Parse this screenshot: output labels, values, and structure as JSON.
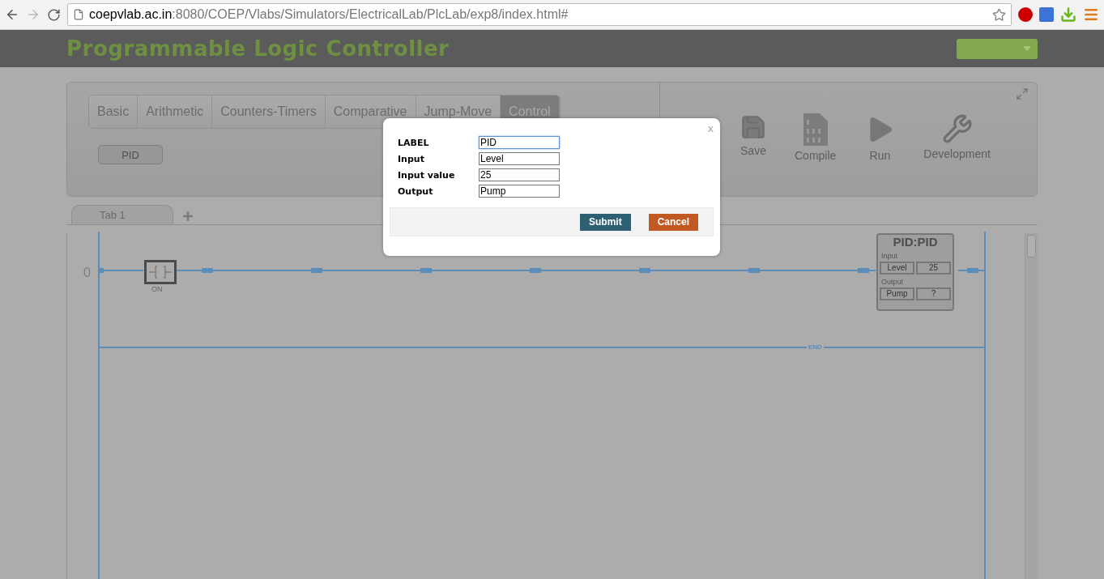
{
  "browser": {
    "url_host": "coepvlab.ac.in",
    "url_path": ":8080/COEP/Vlabs/Simulators/ElectricalLab/PlcLab/exp8/index.html#"
  },
  "header": {
    "title": "Programmable Logic Controller"
  },
  "toolbox": {
    "categories": [
      {
        "label": "Basic",
        "selected": false
      },
      {
        "label": "Arithmetic",
        "selected": false
      },
      {
        "label": "Counters-Timers",
        "selected": false
      },
      {
        "label": "Comparative",
        "selected": false
      },
      {
        "label": "Jump-Move",
        "selected": false
      },
      {
        "label": "Control",
        "selected": true
      }
    ],
    "instructions": [
      {
        "label": "PID"
      }
    ]
  },
  "actions": [
    {
      "label": "Save",
      "kind": "save"
    },
    {
      "label": "Compile",
      "kind": "compile"
    },
    {
      "label": "Run",
      "kind": "run"
    },
    {
      "label": "Development",
      "kind": "development"
    }
  ],
  "sheet_tabs": [
    {
      "label": "Tab 1"
    }
  ],
  "ladder": {
    "rungs": [
      {
        "number": "0",
        "contact": {
          "label": "ON"
        },
        "block": {
          "title": "PID:PID",
          "input_label": "Input",
          "input": "Level",
          "input_value": "25",
          "output_label": "Output",
          "output": "Pump",
          "output_value": "?"
        }
      }
    ],
    "end_label": "END"
  },
  "dialog": {
    "close": "x",
    "fields": [
      {
        "label": "LABEL",
        "value": "PID",
        "focused": true
      },
      {
        "label": "Input",
        "value": "Level",
        "focused": false
      },
      {
        "label": "Input value",
        "value": "25",
        "focused": false
      },
      {
        "label": "Output",
        "value": "Pump",
        "focused": false
      }
    ],
    "buttons": [
      {
        "label": "Submit",
        "kind": "submit"
      },
      {
        "label": "Cancel",
        "kind": "cancel"
      }
    ]
  }
}
